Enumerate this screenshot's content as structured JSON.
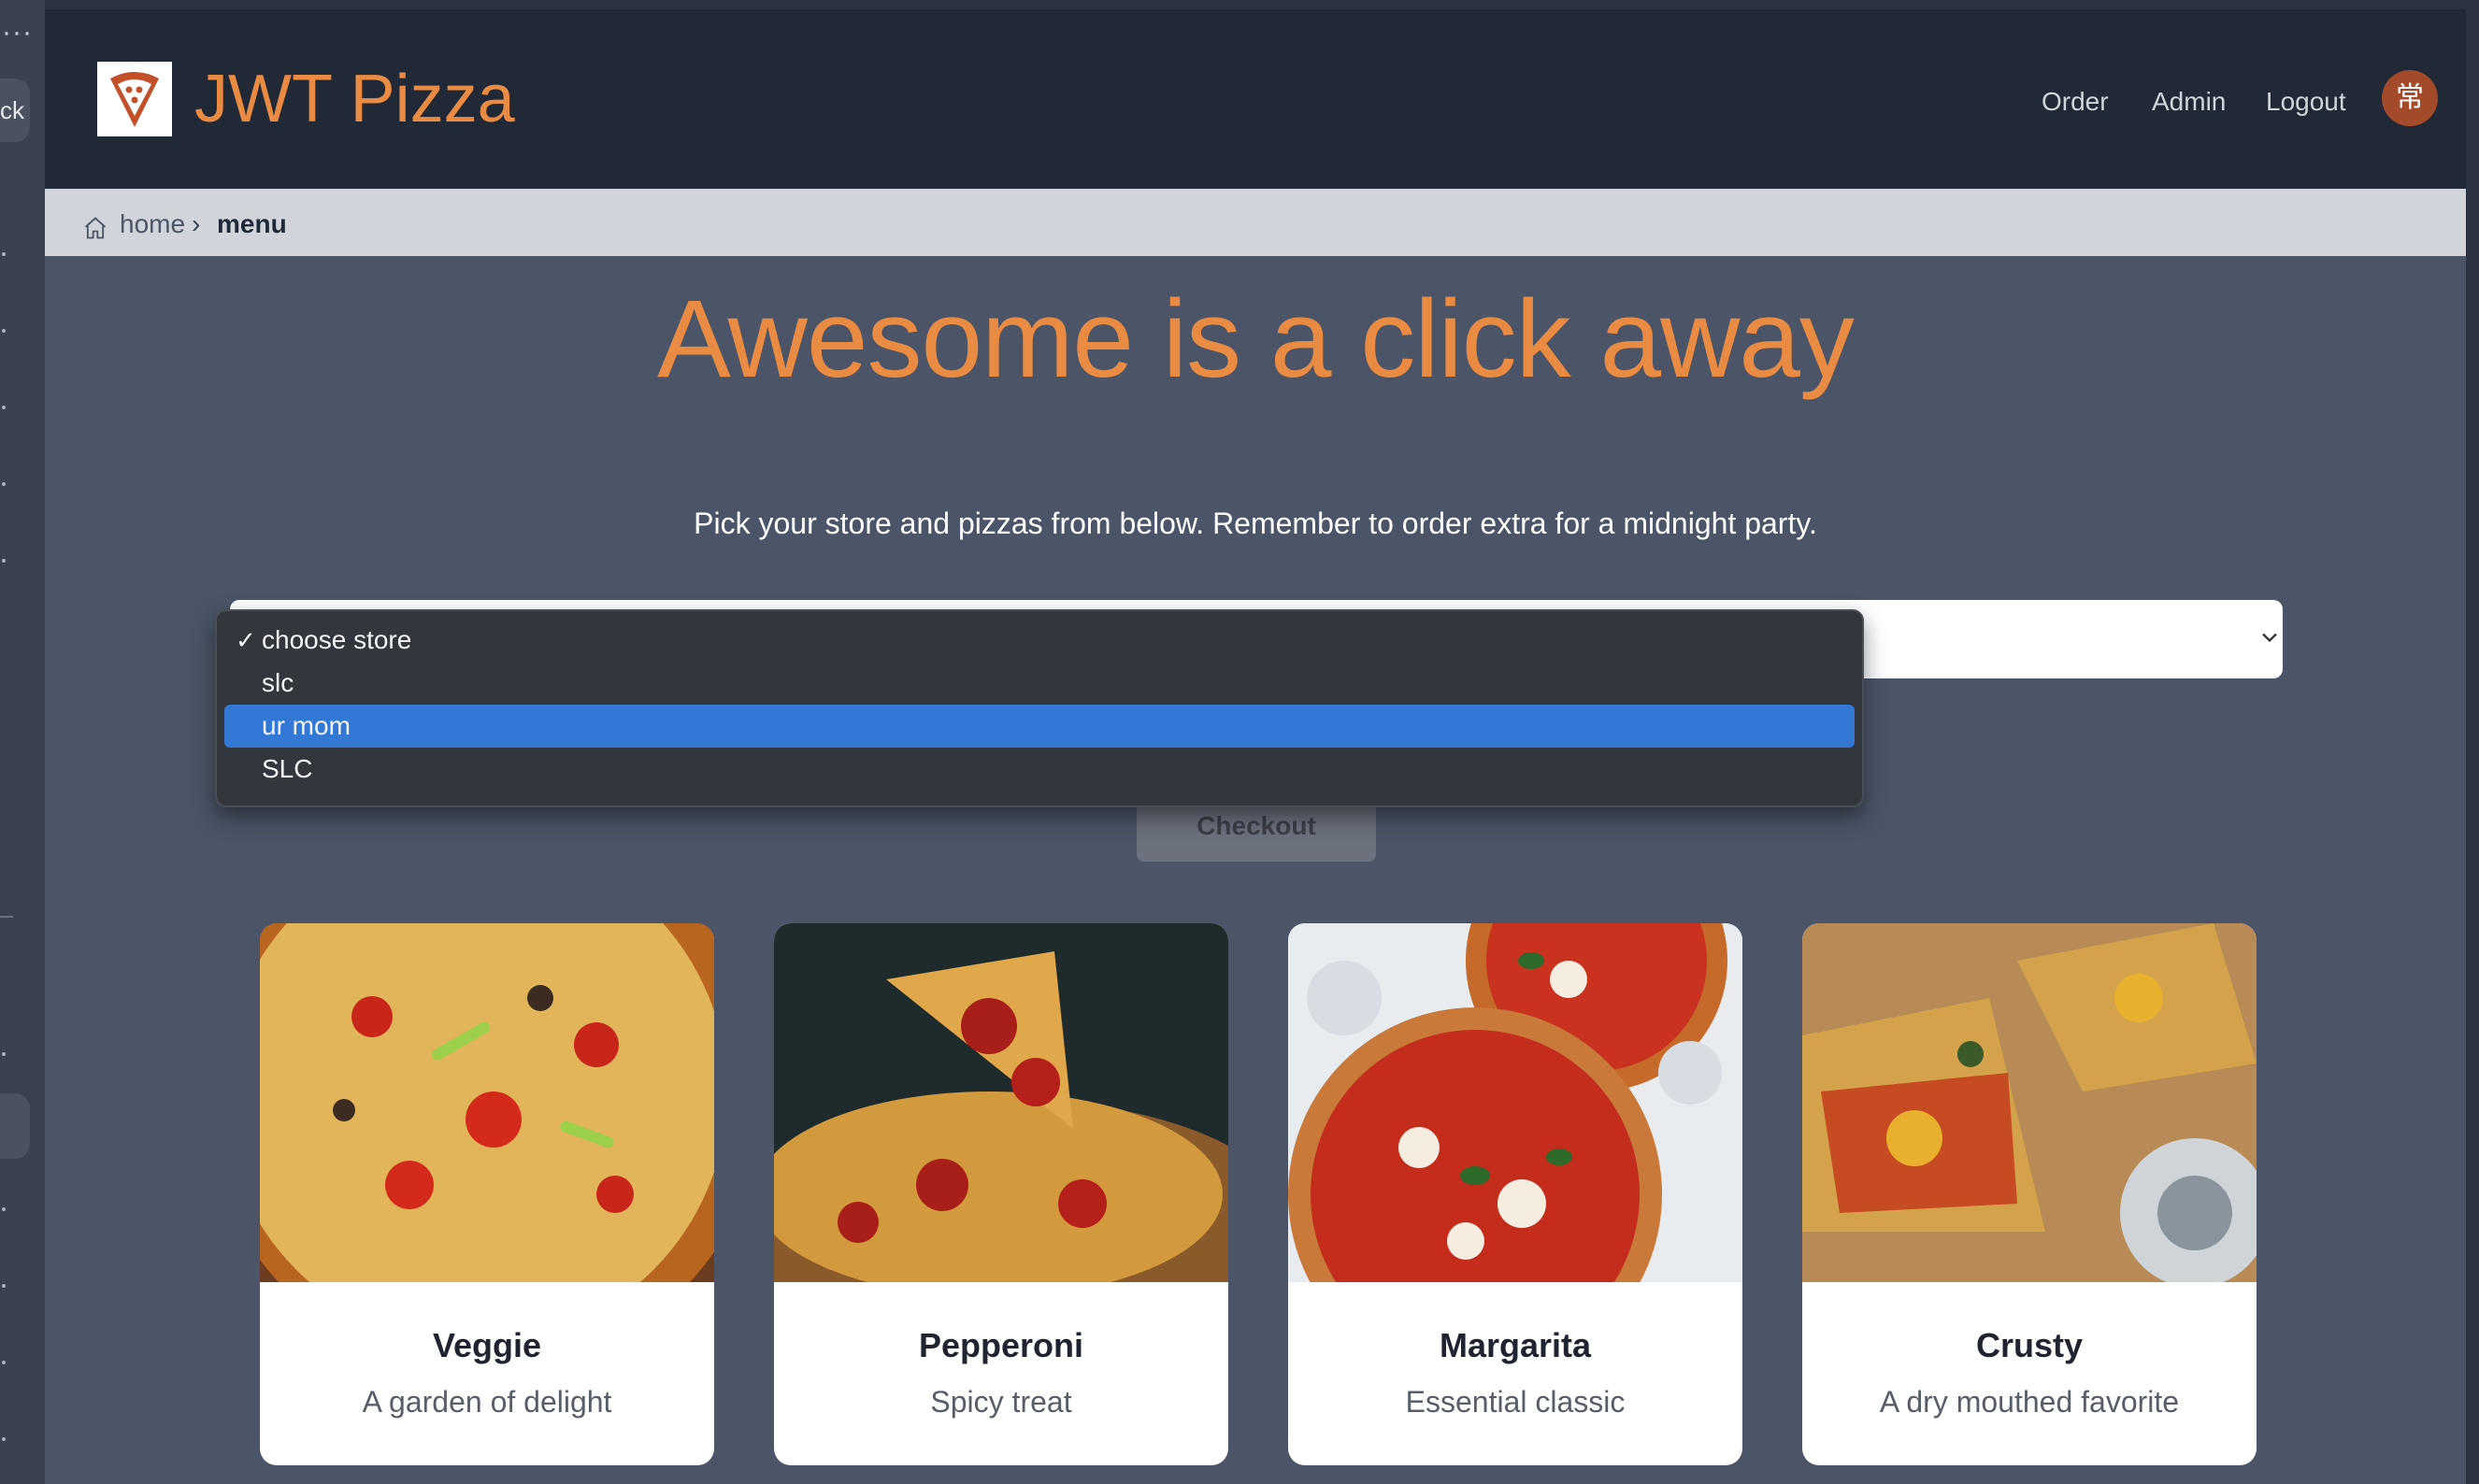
{
  "host": {
    "dots": "···",
    "pill_label": "ck"
  },
  "navbar": {
    "brand": "JWT Pizza",
    "links": [
      "Order",
      "Admin",
      "Logout"
    ],
    "avatar_glyph": "常"
  },
  "breadcrumb": {
    "home": "home",
    "separator": "›",
    "current": "menu"
  },
  "main": {
    "headline": "Awesome is a click away",
    "subtitle": "Pick your store and pizzas from below. Remember to order extra for a midnight party.",
    "checkout_label": "Checkout"
  },
  "store_dropdown": {
    "options": [
      "choose store",
      "slc",
      "ur mom",
      "SLC"
    ],
    "checked_option": "choose store",
    "highlighted_option": "ur mom",
    "check_glyph": "✓"
  },
  "menu_items": [
    {
      "title": "Veggie",
      "description": "A garden of delight"
    },
    {
      "title": "Pepperoni",
      "description": "Spicy treat"
    },
    {
      "title": "Margarita",
      "description": "Essential classic"
    },
    {
      "title": "Crusty",
      "description": "A dry mouthed favorite"
    }
  ],
  "colors": {
    "navbar_bg": "#222936",
    "brand_orange": "#ea8b43",
    "page_bg": "#4b5567",
    "breadcrumb_bg": "#d1d5db",
    "dropdown_highlight": "#3478d6",
    "avatar_bg": "#a34a2a"
  },
  "icons": [
    "pizza-logo-icon",
    "home-icon",
    "chevron-down-icon",
    "checkmark-icon"
  ]
}
